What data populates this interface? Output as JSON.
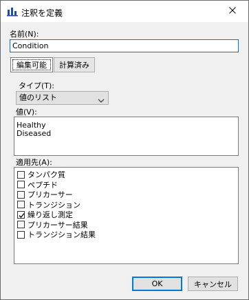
{
  "window": {
    "title": "注釈を定義",
    "icons": {
      "app": "bar-chart-icon",
      "close": "close-icon"
    }
  },
  "form": {
    "name_label": "名前(N):",
    "name_value": "Condition",
    "tabs": [
      {
        "label": "編集可能",
        "active": true
      },
      {
        "label": "計算済み",
        "active": false
      }
    ],
    "type_label": "タイプ(T):",
    "type_selected": "値のリスト",
    "values_label": "値(V):",
    "values": [
      "Healthy",
      "Diseased"
    ],
    "apply_label": "適用先(A):",
    "apply_items": [
      {
        "label": "タンパク質",
        "checked": false
      },
      {
        "label": "ペプチド",
        "checked": false
      },
      {
        "label": "プリカーサー",
        "checked": false
      },
      {
        "label": "トランジション",
        "checked": false
      },
      {
        "label": "繰り返し測定",
        "checked": true
      },
      {
        "label": "プリカーサー結果",
        "checked": false
      },
      {
        "label": "トランジション結果",
        "checked": false
      }
    ]
  },
  "buttons": {
    "ok": "OK",
    "cancel": "キャンセル"
  }
}
